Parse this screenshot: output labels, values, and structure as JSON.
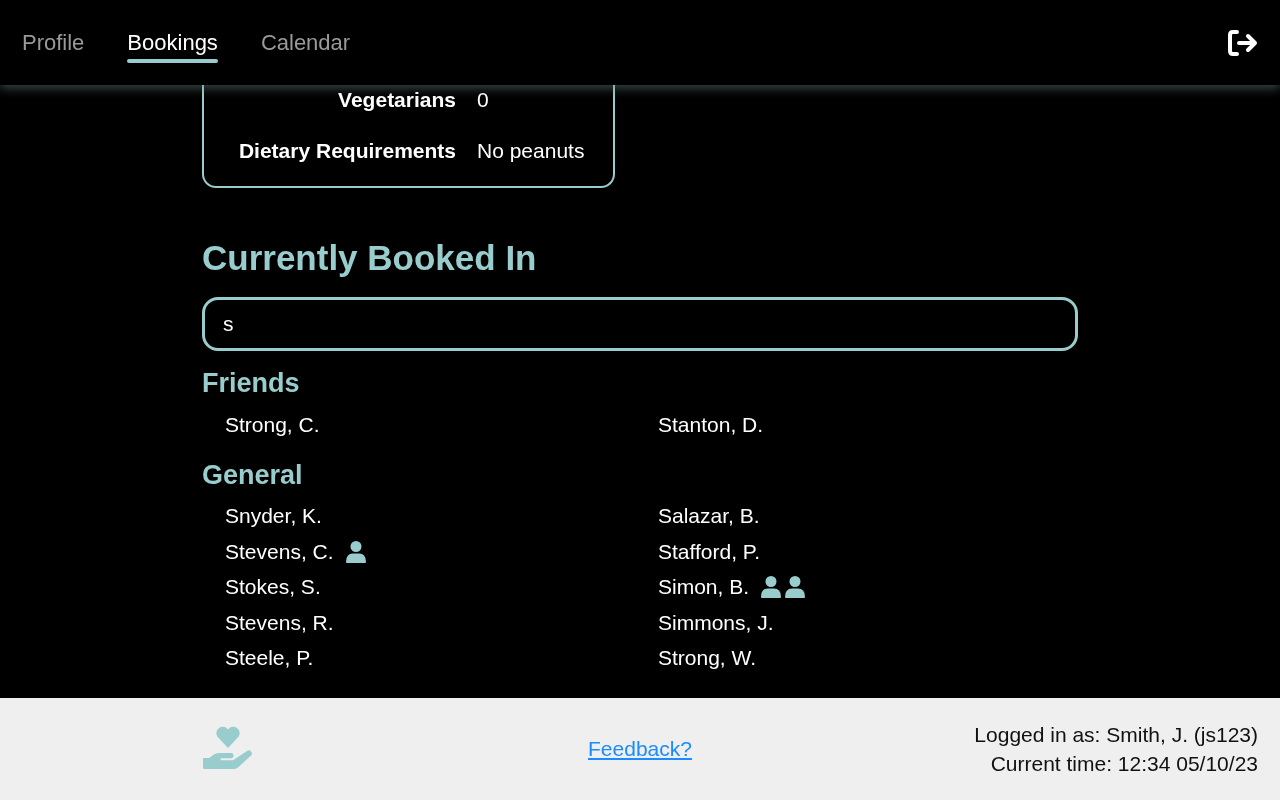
{
  "nav": {
    "tabs": [
      {
        "label": "Profile",
        "selected": false
      },
      {
        "label": "Bookings",
        "selected": true
      },
      {
        "label": "Calendar",
        "selected": false
      }
    ]
  },
  "details": [
    {
      "label": "Vegetarians",
      "value": "0"
    },
    {
      "label": "Dietary Requirements",
      "value": "No peanuts"
    }
  ],
  "booked": {
    "title": "Currently Booked In",
    "search": {
      "value": "s"
    },
    "groups": [
      {
        "title": "Friends",
        "people": [
          {
            "name": "Strong, C."
          },
          {
            "name": "Stanton, D."
          }
        ]
      },
      {
        "title": "General",
        "people": [
          {
            "name": "Snyder, K."
          },
          {
            "name": "Salazar, B."
          },
          {
            "name": "Stevens, C.",
            "guests": [
              {
                "kind": "person"
              }
            ]
          },
          {
            "name": "Stafford, P."
          },
          {
            "name": "Stokes, S."
          },
          {
            "name": "Simon, B.",
            "guests": [
              {
                "kind": "person"
              },
              {
                "kind": "person"
              }
            ]
          },
          {
            "name": "Stevens, R."
          },
          {
            "name": "Simmons, J."
          },
          {
            "name": "Steele, P."
          },
          {
            "name": "Strong, W."
          }
        ]
      }
    ]
  },
  "footer": {
    "feedback": "Feedback?",
    "lines": [
      "Logged in as: Smith, J. (js123)",
      "Current time: 12:34 05/10/23"
    ]
  }
}
